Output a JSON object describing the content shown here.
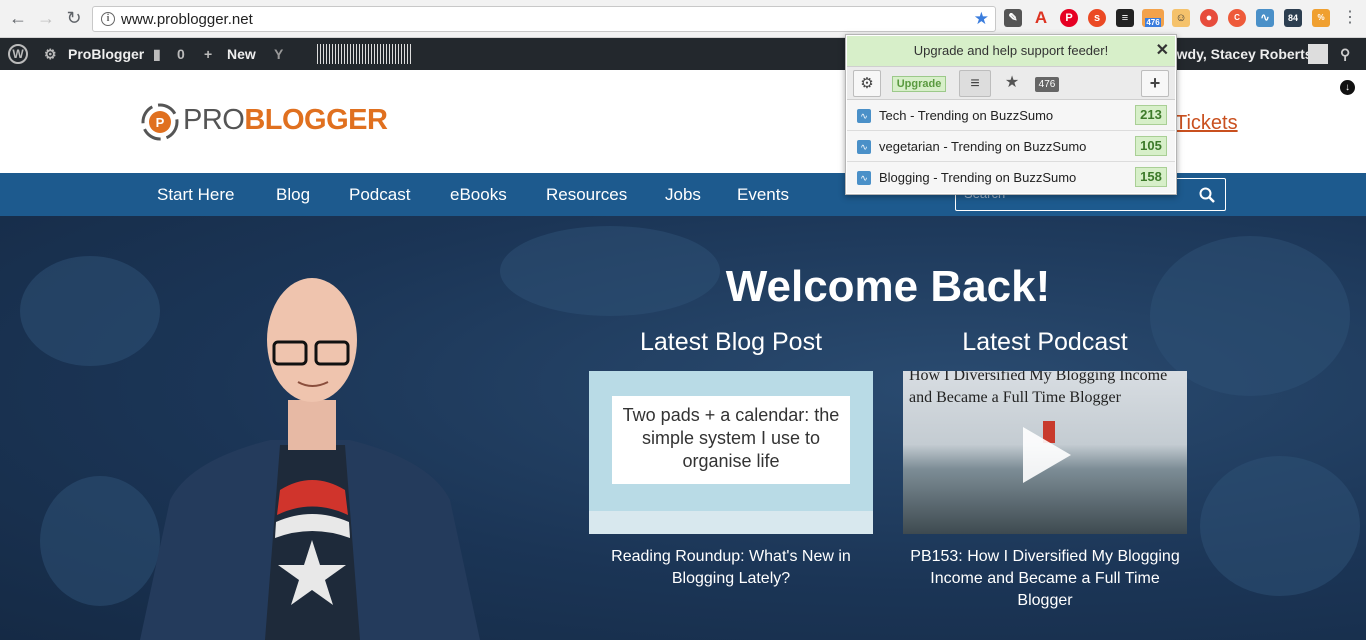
{
  "browser": {
    "url": "www.problogger.net",
    "feeder_badge": "476",
    "ext_badge": "84"
  },
  "wp_admin_bar": {
    "site_name": "ProBlogger",
    "comments_count": "0",
    "new_label": "New",
    "howdy": "Howdy, Stacey Roberts"
  },
  "header": {
    "logo_pro": "PRO",
    "logo_blogger": "BLOGGER",
    "tickets_link": "Tickets"
  },
  "nav": {
    "items": [
      "Start Here",
      "Blog",
      "Podcast",
      "eBooks",
      "Resources",
      "Jobs",
      "Events"
    ],
    "search_placeholder": "Search"
  },
  "hero": {
    "title": "Welcome Back!",
    "blog": {
      "heading": "Latest Blog Post",
      "image_text": "Two pads + a calendar: the simple system I use to organise life",
      "caption": "Reading Roundup: What's New in Blogging Lately?"
    },
    "podcast": {
      "heading": "Latest Podcast",
      "image_text": "How I Diversified My Blogging Income and Became a Full Time Blogger",
      "caption": "PB153: How I Diversified My Blogging Income and Became a Full Time Blogger"
    }
  },
  "feeder_popup": {
    "banner": "Upgrade and help support feeder!",
    "upgrade_label": "Upgrade",
    "unread_count": "476",
    "feeds": [
      {
        "name": "Tech - Trending on BuzzSumo",
        "count": "213"
      },
      {
        "name": "vegetarian - Trending on BuzzSumo",
        "count": "105"
      },
      {
        "name": "Blogging - Trending on BuzzSumo",
        "count": "158"
      }
    ]
  },
  "colors": {
    "nav_blue": "#1d5a8e",
    "brand_orange": "#e0701f",
    "feeder_green": "#d7efc9"
  }
}
